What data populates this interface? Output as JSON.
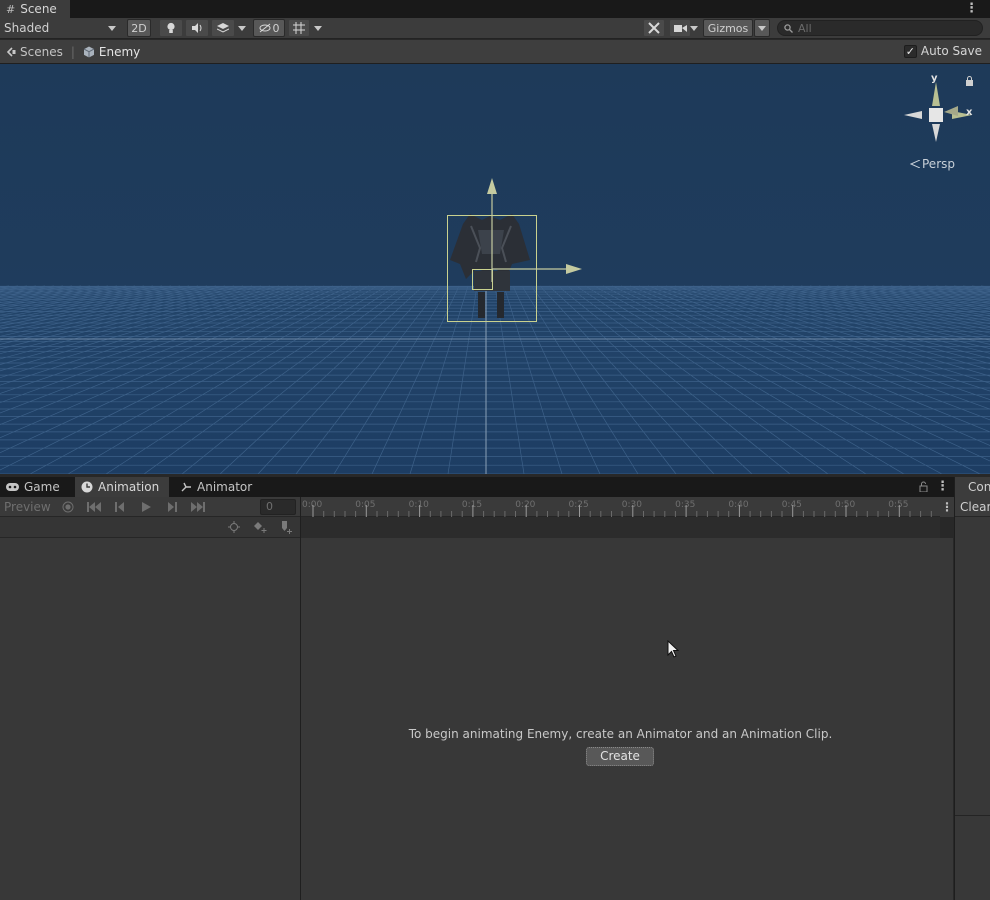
{
  "scene_tab": {
    "label": "Scene"
  },
  "toolbar": {
    "shading_mode": "Shaded",
    "mode_2d": "2D",
    "hidden_count": "0",
    "gizmos_label": "Gizmos",
    "search_placeholder": "All"
  },
  "breadcrumb": {
    "scenes_label": "Scenes",
    "prefab_label": "Enemy",
    "auto_save_label": "Auto Save",
    "auto_save_checked": true
  },
  "gizmo": {
    "y_label": "y",
    "x_label": "x",
    "projection_label": "Persp"
  },
  "lower_tabs": [
    {
      "label": "Game",
      "icon": "gamepad-icon"
    },
    {
      "label": "Animation",
      "icon": "clock-icon",
      "active": true
    },
    {
      "label": "Animator",
      "icon": "animator-icon"
    }
  ],
  "animation": {
    "preview_label": "Preview",
    "frame_value": "0",
    "ruler_ticks": [
      "0:00",
      "0:05",
      "0:10",
      "0:15",
      "0:20",
      "0:25",
      "0:30",
      "0:35",
      "0:40",
      "0:45",
      "0:50",
      "0:55"
    ],
    "empty_message": "To begin animating Enemy, create an Animator and an Animation Clip.",
    "create_label": "Create"
  },
  "console": {
    "tab_label": "Console",
    "clear_label": "Clear"
  },
  "colors": {
    "viewport_sky": "#1f3b5b",
    "selection_box": "#c9d18e",
    "axis_handle": "#c4caa0"
  }
}
